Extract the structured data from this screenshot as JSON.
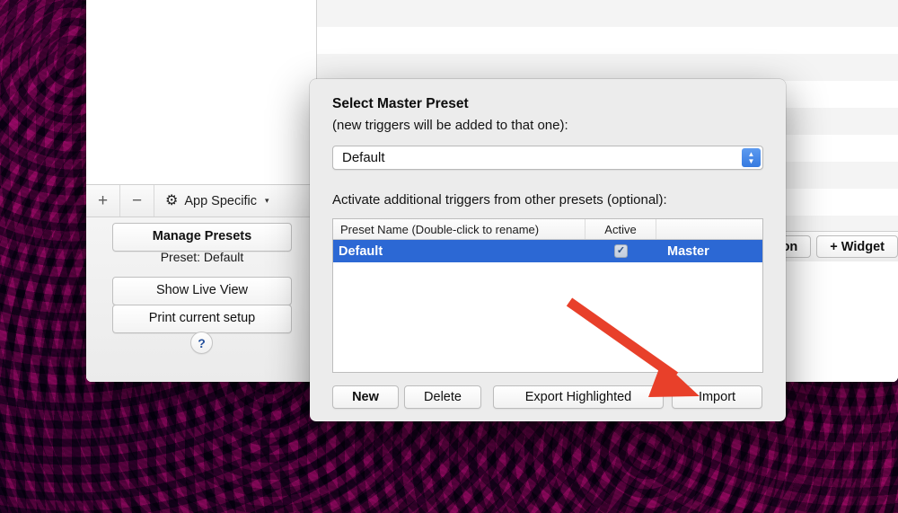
{
  "window": {
    "left_pane": {
      "toolbar": {
        "add_label": "+",
        "remove_label": "−",
        "gear_icon": "gear-icon",
        "gear_label": "App Specific",
        "caret_icon": "chevron-down-icon"
      },
      "manage_presets_label": "Manage Presets",
      "preset_status": "Preset: Default",
      "show_live_view_label": "Show Live View",
      "print_setup_label": "Print current setup",
      "help_label": "?"
    },
    "right_pane": {
      "toolbar_buttons": [
        {
          "label": "+ Button"
        },
        {
          "label": "+ Widget"
        }
      ],
      "stripe_rows": 11
    }
  },
  "sheet": {
    "title": "Select Master Preset",
    "subtitle": "(new triggers will be added to that one):",
    "master_select": {
      "value": "Default",
      "stepper_up_icon": "chevron-up-icon",
      "stepper_down_icon": "chevron-down-icon"
    },
    "hint": "Activate additional triggers from other presets (optional):",
    "table": {
      "columns": [
        "Preset Name (Double-click to rename)",
        "Active",
        ""
      ],
      "rows": [
        {
          "name": "Default",
          "active": true,
          "check_glyph": "✓",
          "role": "Master",
          "selected": true
        }
      ]
    },
    "buttons": {
      "new_label": "New",
      "delete_label": "Delete",
      "export_label": "Export Highlighted",
      "import_label": "Import"
    }
  },
  "annotation": {
    "arrow_color": "#e8402a",
    "arrow_target": "import-button"
  }
}
